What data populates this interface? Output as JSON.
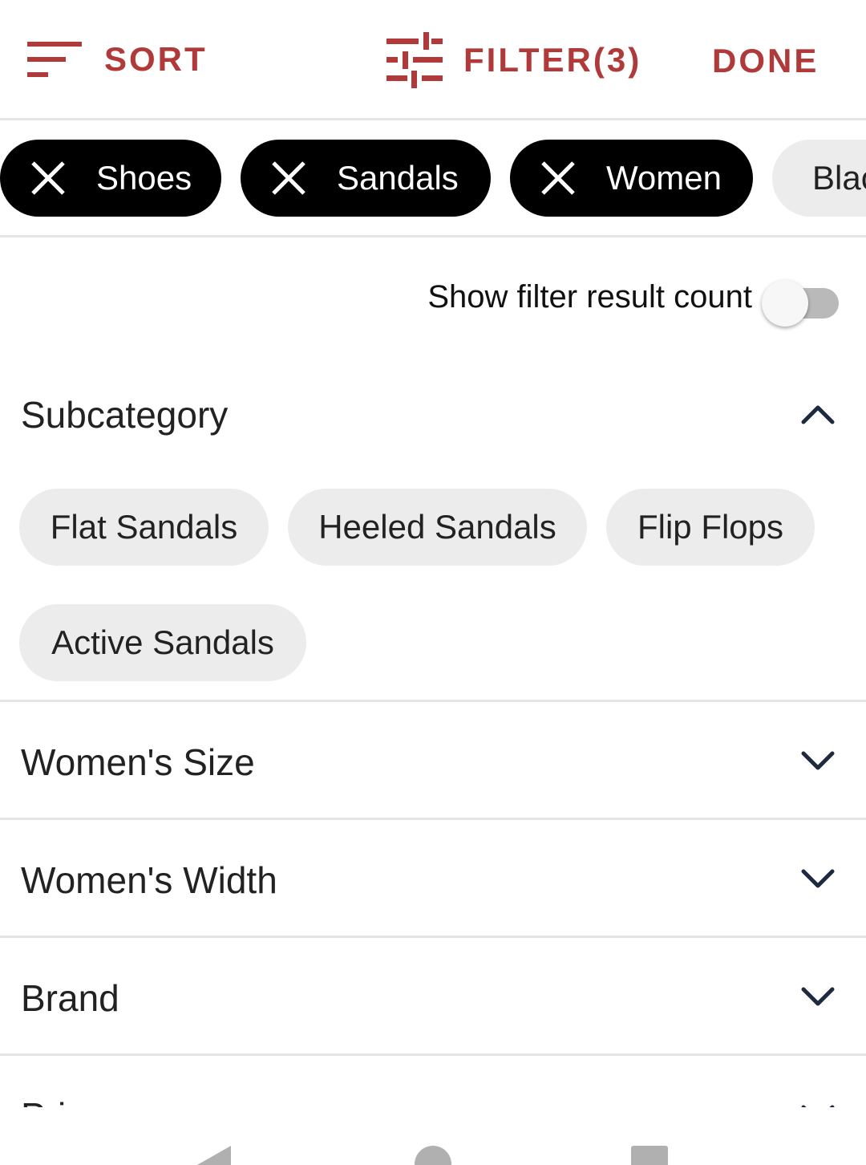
{
  "toolbar": {
    "sort_label": "SORT",
    "filter_label": "FILTER(3)",
    "done_label": "DONE",
    "accent_color": "#b03a3a",
    "sort_icon": "sort-lines-icon",
    "filter_icon": "sliders-icon"
  },
  "active_filters": [
    {
      "label": "Shoes",
      "icon": "close-icon"
    },
    {
      "label": "Sandals",
      "icon": "close-icon"
    },
    {
      "label": "Women",
      "icon": "close-icon"
    },
    {
      "label": "Blac"
    }
  ],
  "result_count_toggle": {
    "label": "Show filter result count",
    "on": false
  },
  "sections": {
    "subcategory": {
      "title": "Subcategory",
      "expanded": true,
      "options": [
        "Flat Sandals",
        "Heeled Sandals",
        "Flip Flops",
        "Active Sandals"
      ]
    },
    "womens_size": {
      "title": "Women's Size",
      "expanded": false
    },
    "womens_width": {
      "title": "Women's Width",
      "expanded": false
    },
    "brand": {
      "title": "Brand",
      "expanded": false
    },
    "price": {
      "title": "Price",
      "expanded": false
    }
  },
  "navbar": {
    "back_icon": "back-triangle-icon",
    "home_icon": "home-circle-icon",
    "recents_icon": "recents-square-icon"
  }
}
